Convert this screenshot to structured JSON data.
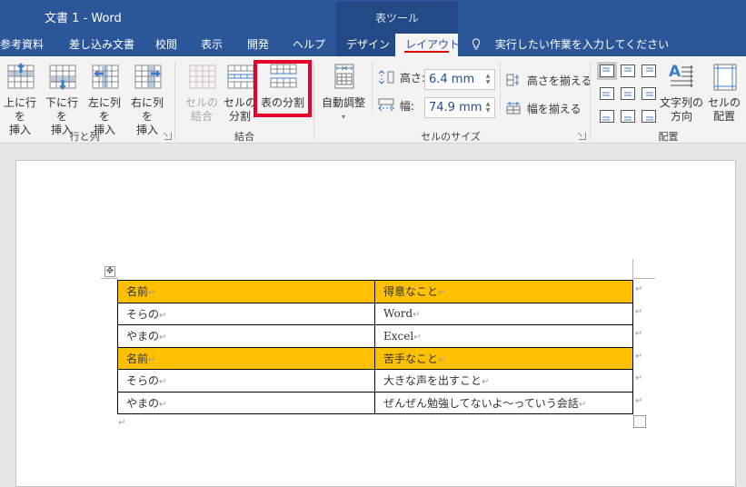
{
  "window": {
    "title": "文書 1  -  Word"
  },
  "context_tab_group": {
    "label": "表ツール"
  },
  "tabs": [
    {
      "label": "参考資料",
      "active": false
    },
    {
      "label": "差し込み文書",
      "active": false
    },
    {
      "label": "校閲",
      "active": false
    },
    {
      "label": "表示",
      "active": false
    },
    {
      "label": "開発",
      "active": false
    },
    {
      "label": "ヘルプ",
      "active": false
    },
    {
      "label": "デザイン",
      "active": false
    },
    {
      "label": "レイアウト",
      "active": true
    }
  ],
  "tell_me": {
    "icon": "lightbulb-icon",
    "placeholder": "実行したい作業を入力してください"
  },
  "ribbon": {
    "rows_columns": {
      "label": "行と列",
      "buttons": [
        {
          "line1": "上に行を",
          "line2": "挿入",
          "icon": "insert-row-above-icon"
        },
        {
          "line1": "下に行を",
          "line2": "挿入",
          "icon": "insert-row-below-icon"
        },
        {
          "line1": "左に列を",
          "line2": "挿入",
          "icon": "insert-column-left-icon"
        },
        {
          "line1": "右に列を",
          "line2": "挿入",
          "icon": "insert-column-right-icon"
        }
      ]
    },
    "merge": {
      "label": "結合",
      "buttons": [
        {
          "line1": "セルの",
          "line2": "結合",
          "icon": "merge-cells-icon",
          "disabled": true
        },
        {
          "line1": "セルの",
          "line2": "分割",
          "icon": "split-cells-icon",
          "disabled": false
        },
        {
          "line1": "表の分割",
          "line2": "",
          "icon": "split-table-icon",
          "disabled": false,
          "highlighted": true
        }
      ]
    },
    "cell_size": {
      "label": "セルのサイズ",
      "autofit": {
        "label": "自動調整",
        "icon": "autofit-icon"
      },
      "height": {
        "label": "高さ:",
        "value": "6.4 mm"
      },
      "width": {
        "label": "幅:",
        "value": "74.9 mm"
      },
      "distribute_rows": "高さを揃える",
      "distribute_columns": "幅を揃える"
    },
    "alignment": {
      "label": "配置",
      "grid": [
        "top-left",
        "top-center",
        "top-right",
        "middle-left",
        "middle-center",
        "middle-right",
        "bottom-left",
        "bottom-center",
        "bottom-right"
      ],
      "selected": "top-left",
      "text_direction": {
        "line1": "文字列の",
        "line2": "方向"
      },
      "cell_margins": {
        "line1": "セルの",
        "line2": "配置"
      }
    }
  },
  "document": {
    "table": {
      "rows": [
        {
          "header": true,
          "cells": [
            "名前",
            "得意なこと"
          ]
        },
        {
          "header": false,
          "cells": [
            "そらの",
            "Word"
          ]
        },
        {
          "header": false,
          "cells": [
            "やまの",
            "Excel"
          ]
        },
        {
          "header": true,
          "cells": [
            "名前",
            "苦手なこと"
          ]
        },
        {
          "header": false,
          "cells": [
            "そらの",
            "大きな声を出すこと"
          ]
        },
        {
          "header": false,
          "cells": [
            "やまの",
            "ぜんぜん勉強してないよ～っていう会話"
          ]
        }
      ]
    },
    "paragraph_mark": "↵",
    "highlight_color": "#ffc000"
  },
  "colors": {
    "accent": "#2b579a",
    "context_tab": "#234a86",
    "highlight_border": "#e8002b"
  }
}
